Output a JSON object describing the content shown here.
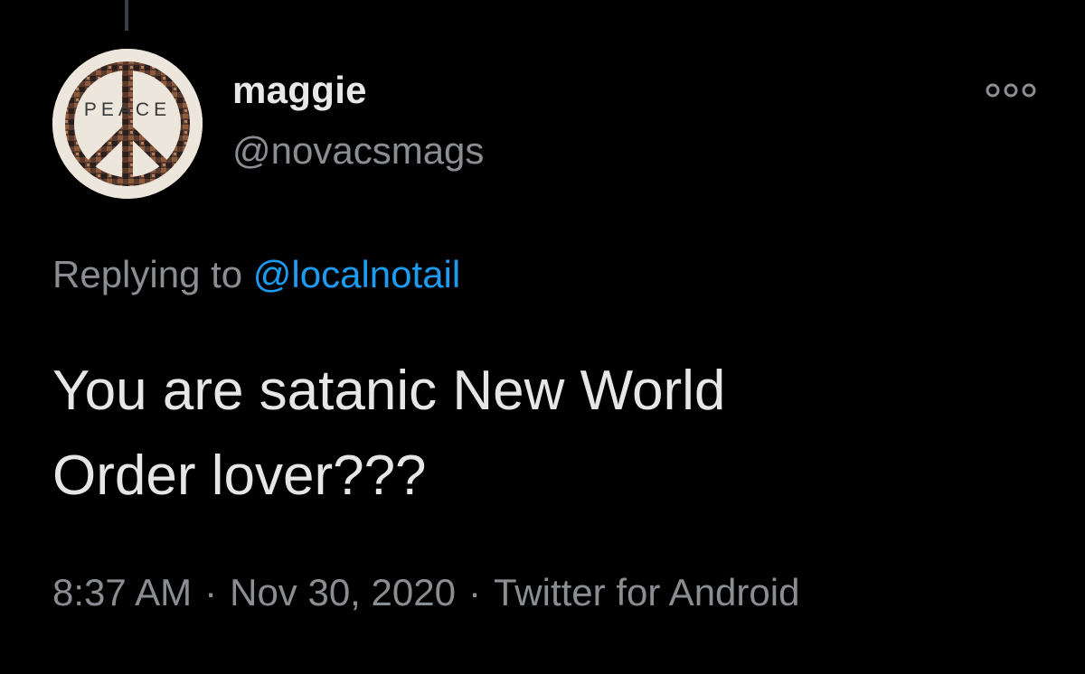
{
  "tweet": {
    "author": {
      "name": "maggie",
      "handle": "@novacsmags",
      "avatar_text": "PEACE",
      "avatar_icon": "peace-sign-icon"
    },
    "more_icon": "more-options-icon",
    "reply": {
      "prefix": "Replying to",
      "mention": "@localnotail"
    },
    "text_line1": "You are satanic New World",
    "text_line2": "Order lover???",
    "meta": {
      "time": "8:37 AM",
      "separator": "·",
      "date": "Nov 30, 2020",
      "source": "Twitter for Android"
    }
  },
  "colors": {
    "background": "#000000",
    "link": "#1d9bf0",
    "secondary_text": "#8a8d91",
    "primary_text": "#e6e6e6"
  }
}
